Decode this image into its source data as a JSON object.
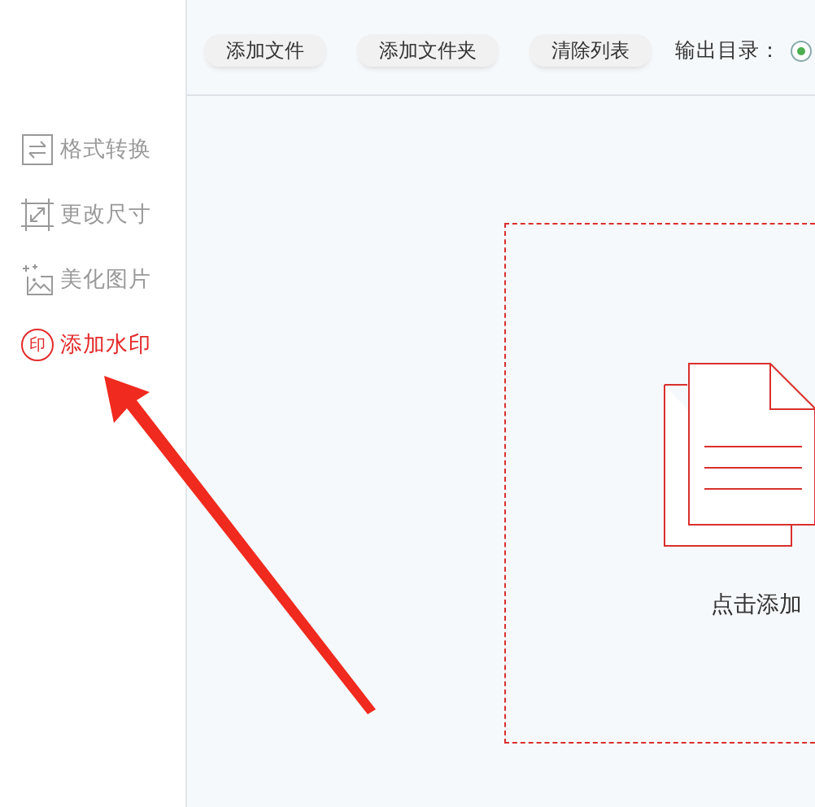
{
  "sidebar": {
    "items": [
      {
        "label": "格式转换",
        "selected": false
      },
      {
        "label": "更改尺寸",
        "selected": false
      },
      {
        "label": "美化图片",
        "selected": false
      },
      {
        "label": "添加水印",
        "selected": true,
        "icon_text": "印"
      }
    ]
  },
  "toolbar": {
    "buttons": [
      "添加文件",
      "添加文件夹",
      "清除列表"
    ],
    "output_label": "输出目录：",
    "output_option": {
      "selected": true
    }
  },
  "drop_zone": {
    "text": "点击添加"
  }
}
